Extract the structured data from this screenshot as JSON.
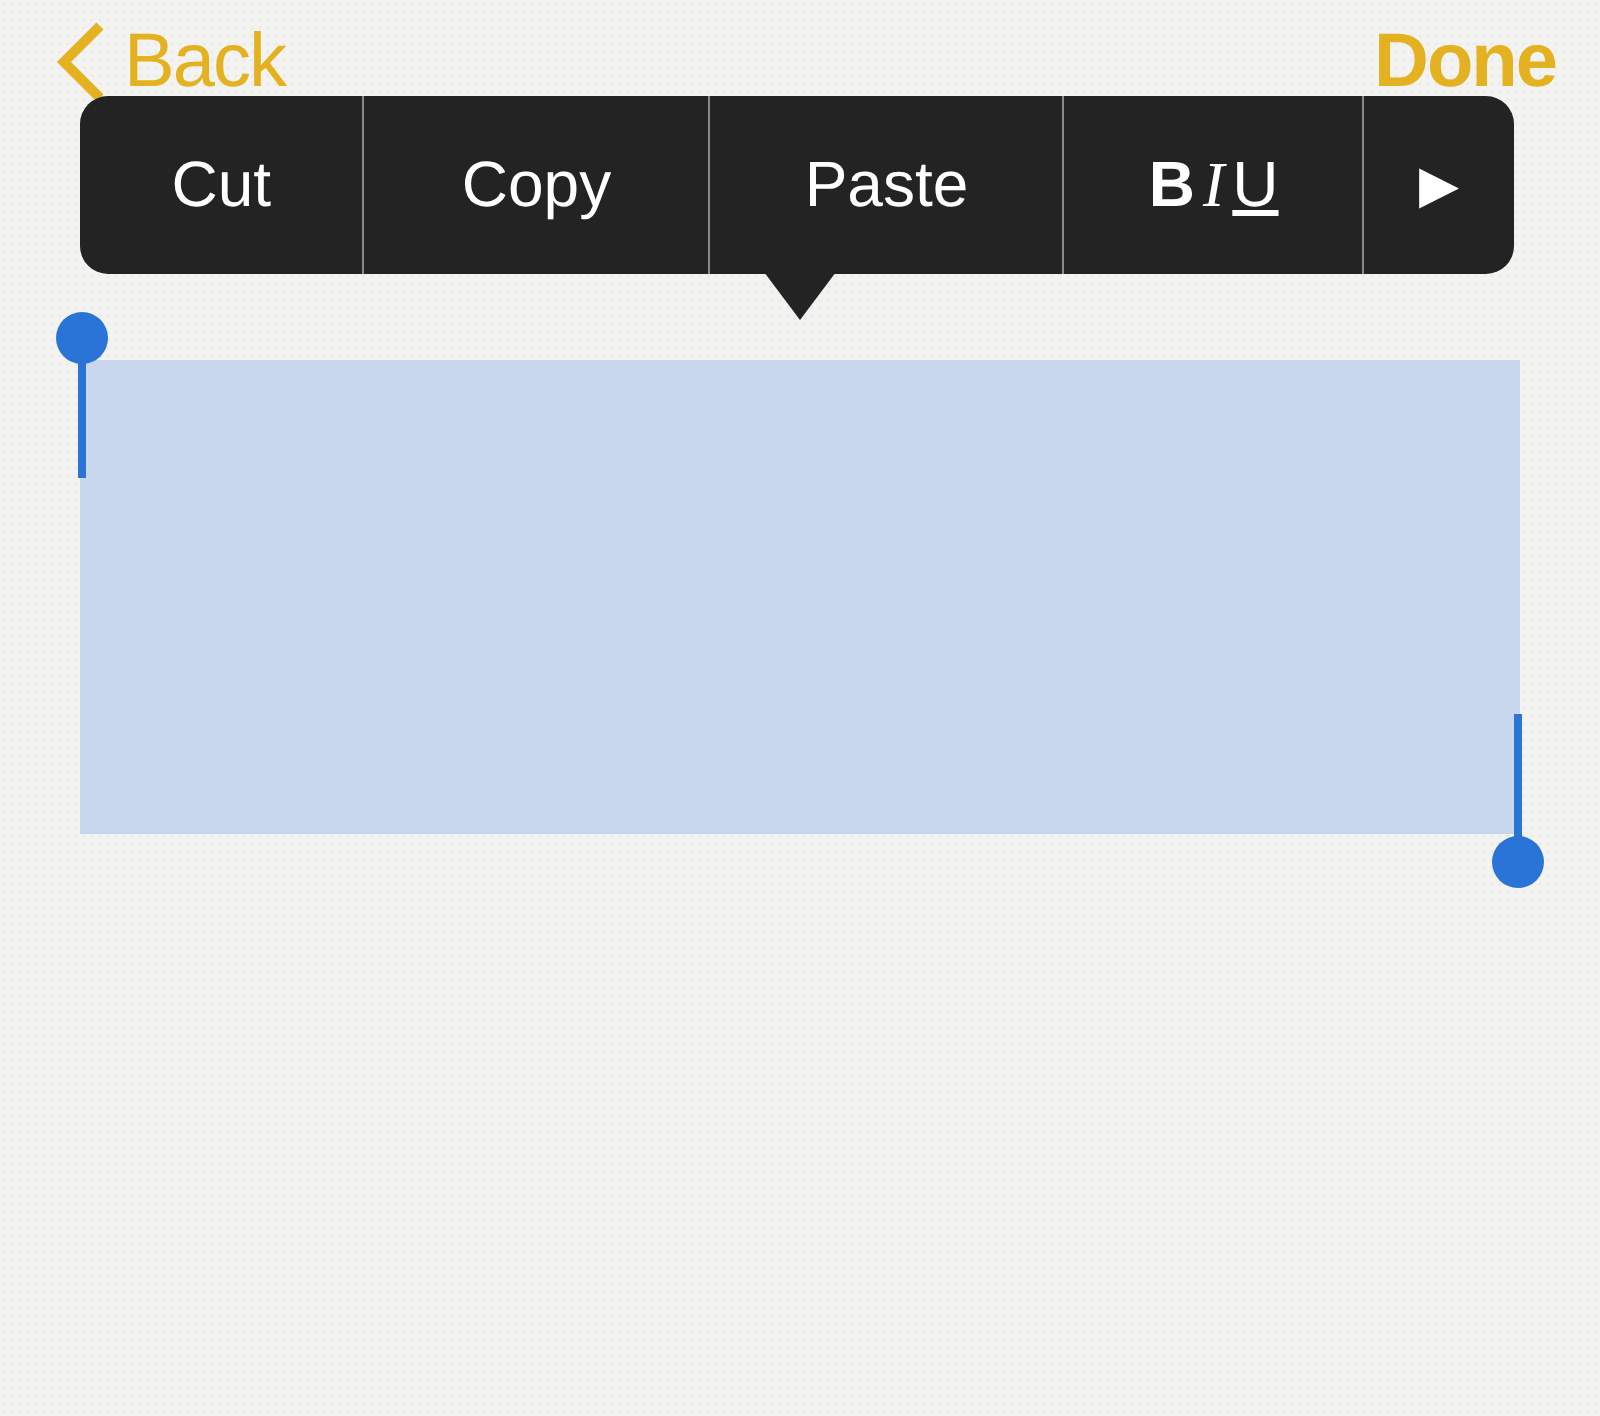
{
  "nav": {
    "back": "Back",
    "done": "Done"
  },
  "menu": {
    "items": [
      {
        "kind": "text",
        "label": "Cut"
      },
      {
        "kind": "text",
        "label": "Copy"
      },
      {
        "kind": "text",
        "label": "Paste"
      },
      {
        "kind": "format",
        "bold": "B",
        "italic": "I",
        "underline": "U"
      },
      {
        "kind": "more",
        "label": "▶"
      }
    ]
  }
}
